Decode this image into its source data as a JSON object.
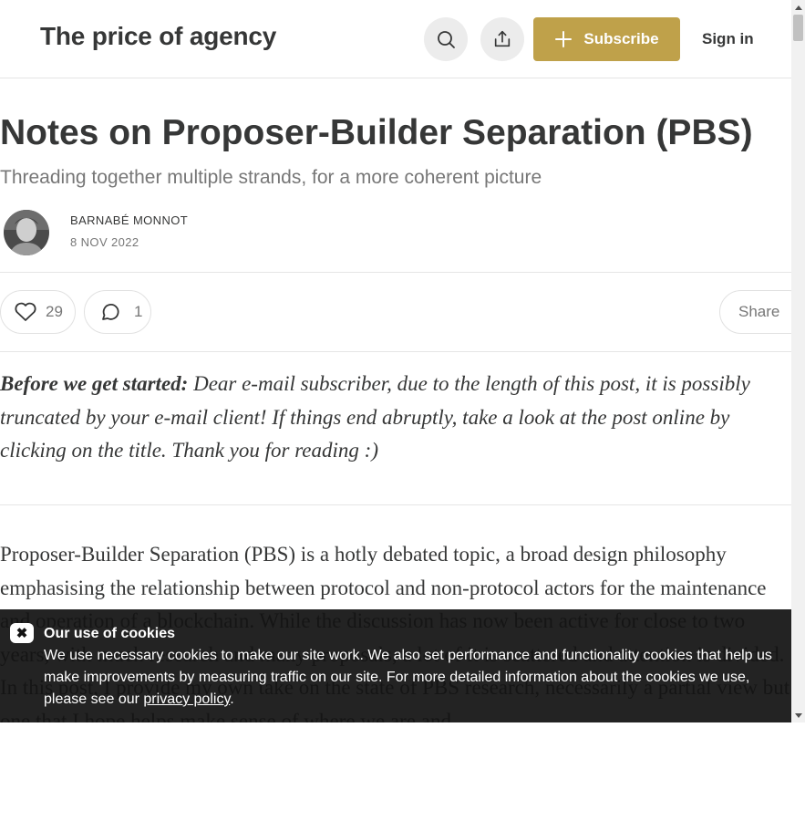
{
  "header": {
    "publication_title": "The price of agency",
    "subscribe_label": "Subscribe",
    "signin_label": "Sign in",
    "search_icon": "search-icon",
    "share_icon": "share-upload-icon"
  },
  "post": {
    "title": "Notes on Proposer-Builder Separation (PBS)",
    "subtitle": "Threading together multiple strands, for a more coherent picture",
    "author": "BARNABÉ MONNOT",
    "date": "8 NOV 2022"
  },
  "actions": {
    "likes": "29",
    "comments": "1",
    "share_label": "Share"
  },
  "content": {
    "intro_bold": "Before we get started:",
    "intro_text": " Dear e-mail subscriber, due to the length of this post, it is possibly truncated by your e-mail client! If things end abruptly, take a look at the post online by clicking on the title. Thank you for reading :)",
    "paragraph": "Proposer-Builder Separation (PBS) is a hotly debated topic, a broad design philosophy emphasising the relationship between protocol and non-protocol actors for the maintenance and operation of a blockchain. While the discussion has now been active for close to two years, with much research and many proposals, a lot of it is scattered and attention is divided. In this post, I provide my own take on the state of PBS research, necessarily a partial view but one that I hope helps make sense of where we are and"
  },
  "cookie_banner": {
    "title": "Our use of cookies",
    "text_before_link": "We use necessary cookies to make our site work. We also set performance and functionality cookies that help us make improvements by measuring traffic on our site. For more detailed information about the cookies we use, please see our ",
    "link_text": "privacy policy",
    "text_after_link": "."
  },
  "colors": {
    "accent": "#bfa14a",
    "text": "#363737",
    "muted": "#777777",
    "banner": "#121212"
  }
}
